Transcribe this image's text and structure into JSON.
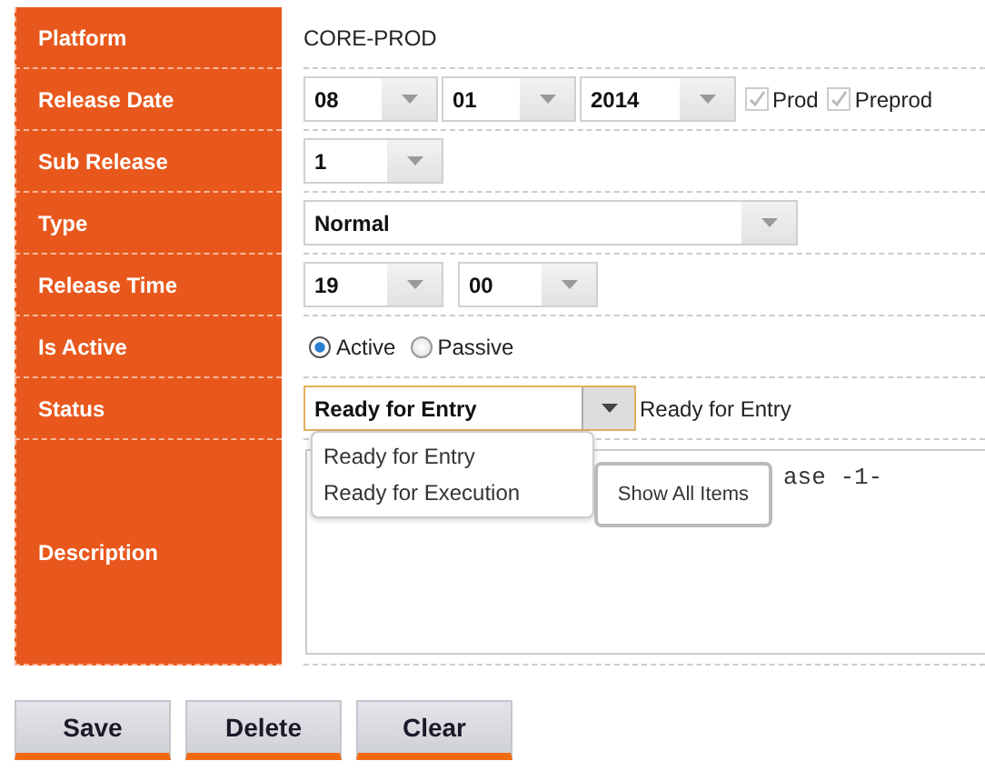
{
  "form": [
    {
      "label": "Platform",
      "kind": "text",
      "value": "CORE-PROD"
    },
    {
      "label": "Release Date",
      "kind": "date",
      "selects": [
        {
          "value": "08"
        },
        {
          "value": "01"
        },
        {
          "value": "2014"
        }
      ],
      "checkboxes": [
        {
          "label": "Prod",
          "checked": true,
          "disabled": true
        },
        {
          "label": "Preprod",
          "checked": true,
          "disabled": true
        }
      ]
    },
    {
      "label": "Sub Release",
      "kind": "short",
      "selects": [
        {
          "value": "1"
        }
      ]
    },
    {
      "label": "Type",
      "kind": "wide",
      "selects": [
        {
          "value": "Normal"
        }
      ]
    },
    {
      "label": "Release Time",
      "kind": "time",
      "selects": [
        {
          "value": "19"
        },
        {
          "value": "00"
        }
      ]
    },
    {
      "label": "Is Active",
      "kind": "radios",
      "radios": [
        {
          "label": "Active",
          "selected": true
        },
        {
          "label": "Passive",
          "selected": false
        }
      ]
    },
    {
      "label": "Status",
      "kind": "status",
      "value": "Ready for Entry",
      "note": "Ready for Entry",
      "options": [
        {
          "label": "Ready for Entry"
        },
        {
          "label": "Ready for Execution"
        }
      ],
      "tooltip": "Show All Items"
    },
    {
      "label": "Description",
      "kind": "description",
      "value": "ase -1-"
    }
  ],
  "buttons": [
    "Save",
    "Delete",
    "Clear"
  ]
}
